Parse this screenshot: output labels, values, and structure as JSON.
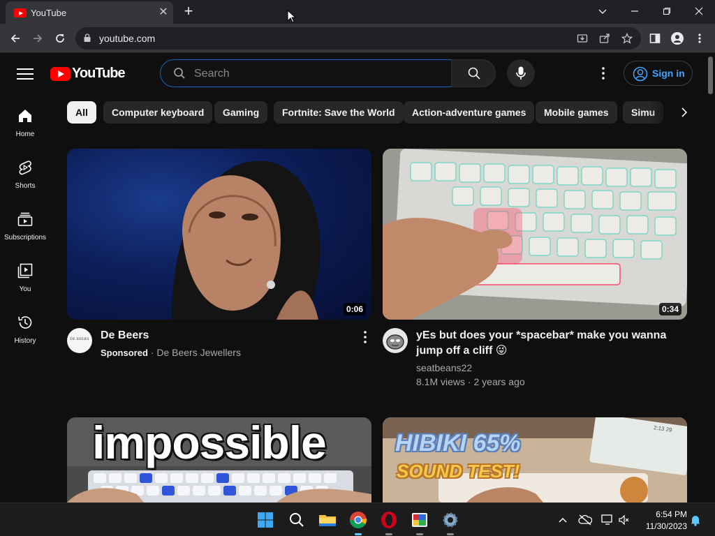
{
  "browser": {
    "tab_title": "YouTube",
    "url": "youtube.com"
  },
  "header": {
    "logo_text": "YouTube",
    "search_placeholder": "Search",
    "signin_label": "Sign in"
  },
  "chips": [
    {
      "label": "All",
      "active": true
    },
    {
      "label": "Computer keyboard"
    },
    {
      "label": "Gaming"
    },
    {
      "label": "Fortnite: Save the World"
    },
    {
      "label": "Action-adventure games"
    },
    {
      "label": "Mobile games"
    },
    {
      "label": "Simu"
    }
  ],
  "sidebar": {
    "items": [
      {
        "label": "Home",
        "icon": "home-icon"
      },
      {
        "label": "Shorts",
        "icon": "shorts-icon"
      },
      {
        "label": "Subscriptions",
        "icon": "subscriptions-icon"
      },
      {
        "label": "You",
        "icon": "you-icon"
      },
      {
        "label": "History",
        "icon": "history-icon"
      }
    ]
  },
  "videos": [
    {
      "title": "De Beers",
      "sponsored_label": "Sponsored",
      "separator": "·",
      "channel": "De Beers Jewellers",
      "duration": "0:06",
      "avatar_text": "DE BEERS"
    },
    {
      "title_line1": "yEs but does your *spacebar* make you wanna",
      "title_line2": "jump off a cliff 😜",
      "channel": "seatbeans22",
      "views": "8.1M views",
      "separator": "·",
      "age": "2 years ago",
      "duration": "0:34"
    },
    {
      "thumb_text": "impossible"
    },
    {
      "thumb_line1": "HIBIKI 65%",
      "thumb_line2": "SOUND TEST!",
      "screen_text": "2:13 29"
    }
  ],
  "taskbar": {
    "time": "6:54 PM",
    "date": "11/30/2023"
  },
  "colors": {
    "yt_red": "#ff0000",
    "link_blue": "#3ea6ff",
    "background": "#0f0f0f"
  }
}
